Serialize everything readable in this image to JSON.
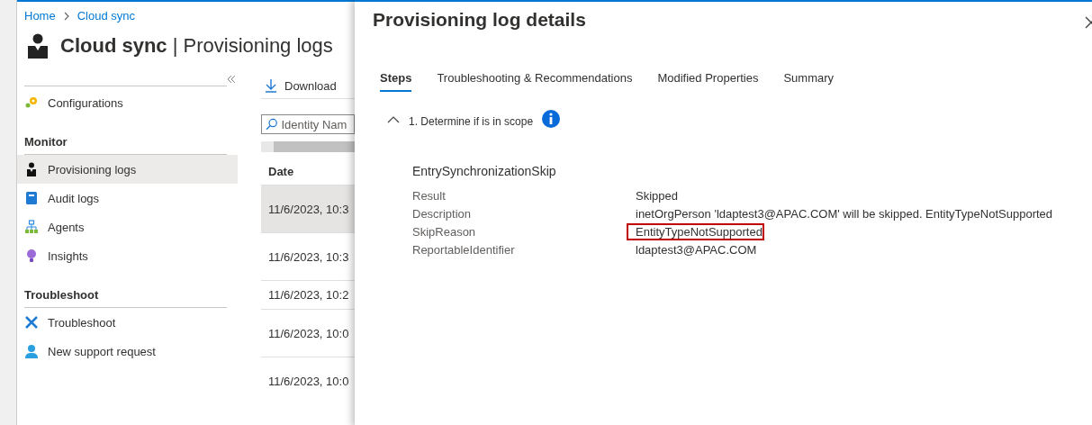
{
  "breadcrumb": [
    "Home",
    "Cloud sync"
  ],
  "page_title": {
    "resource": "Cloud sync",
    "separator": "|",
    "section": "Provisioning logs"
  },
  "sidebar": {
    "items": [
      {
        "kind": "item",
        "label": "Configurations",
        "selected": false
      },
      {
        "kind": "header",
        "label": "Monitor"
      },
      {
        "kind": "item",
        "label": "Provisioning logs",
        "selected": true
      },
      {
        "kind": "item",
        "label": "Audit logs",
        "selected": false
      },
      {
        "kind": "item",
        "label": "Agents",
        "selected": false
      },
      {
        "kind": "item",
        "label": "Insights",
        "selected": false
      },
      {
        "kind": "header",
        "label": "Troubleshoot"
      },
      {
        "kind": "item",
        "label": "Troubleshoot",
        "selected": false
      },
      {
        "kind": "item",
        "label": "New support request",
        "selected": false
      }
    ]
  },
  "toolbar": {
    "download": "Download"
  },
  "search": {
    "placeholder": "Identity Nam"
  },
  "table": {
    "columns": [
      "Date"
    ],
    "rows": [
      {
        "date": "11/6/2023, 10:3",
        "selected": true
      },
      {
        "date": "11/6/2023, 10:3",
        "selected": false
      },
      {
        "date": "11/6/2023, 10:2",
        "selected": false
      },
      {
        "date": "11/6/2023, 10:0",
        "selected": false
      },
      {
        "date": "11/6/2023, 10:0",
        "selected": false
      }
    ]
  },
  "details": {
    "title": "Provisioning log details",
    "tabs": [
      {
        "label": "Steps",
        "selected": true
      },
      {
        "label": "Troubleshooting & Recommendations",
        "selected": false
      },
      {
        "label": "Modified Properties",
        "selected": false
      },
      {
        "label": "Summary",
        "selected": false
      }
    ],
    "step": {
      "label": "1. Determine if is in scope",
      "expanded": true
    },
    "section_title": "EntrySynchronizationSkip",
    "properties": [
      {
        "name": "Result",
        "value": "Skipped",
        "highlighted": false
      },
      {
        "name": "Description",
        "value": "inetOrgPerson 'ldaptest3@APAC.COM' will be skipped. EntityTypeNotSupported",
        "highlighted": false
      },
      {
        "name": "SkipReason",
        "value": "EntityTypeNotSupported",
        "highlighted": true
      },
      {
        "name": "ReportableIdentifier",
        "value": "ldaptest3@APAC.COM",
        "highlighted": false
      }
    ]
  }
}
